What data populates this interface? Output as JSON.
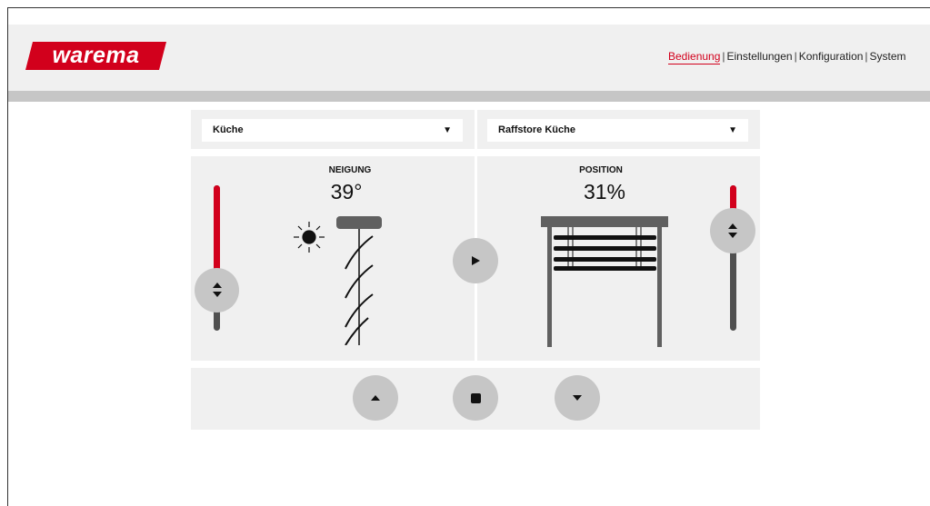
{
  "brand": {
    "logo_text": "warema",
    "color": "#d2001c"
  },
  "nav": {
    "items": [
      "Bedienung",
      "Einstellungen",
      "Konfiguration",
      "System"
    ],
    "separator": "|",
    "active": "Bedienung"
  },
  "selectors": {
    "room": {
      "value": "Küche"
    },
    "device": {
      "value": "Raffstore Küche"
    }
  },
  "tilt": {
    "title": "NEIGUNG",
    "value_text": "39°",
    "slider_level": 0.72
  },
  "position": {
    "title": "POSITION",
    "value_text": "31%",
    "slider_level": 0.31
  },
  "controls": {
    "play": "play-icon",
    "up": "triangle-up-icon",
    "stop": "stop-icon",
    "down": "triangle-down-icon"
  }
}
